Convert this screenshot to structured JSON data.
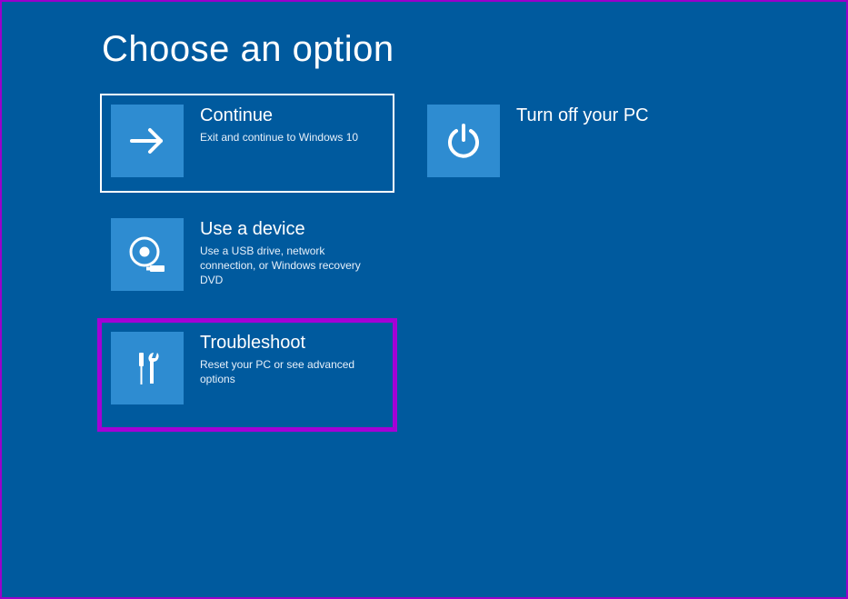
{
  "page": {
    "title": "Choose an option"
  },
  "tiles": {
    "continue": {
      "title": "Continue",
      "desc": "Exit and continue to Windows 10"
    },
    "useDevice": {
      "title": "Use a device",
      "desc": "Use a USB drive, network connection, or Windows recovery DVD"
    },
    "troubleshoot": {
      "title": "Troubleshoot",
      "desc": "Reset your PC or see advanced options"
    },
    "turnOff": {
      "title": "Turn off your PC"
    }
  },
  "colors": {
    "background": "#005a9e",
    "tileIcon": "#2e8cd1",
    "highlight": "#a400d6",
    "outerBorder": "#9900cc"
  }
}
